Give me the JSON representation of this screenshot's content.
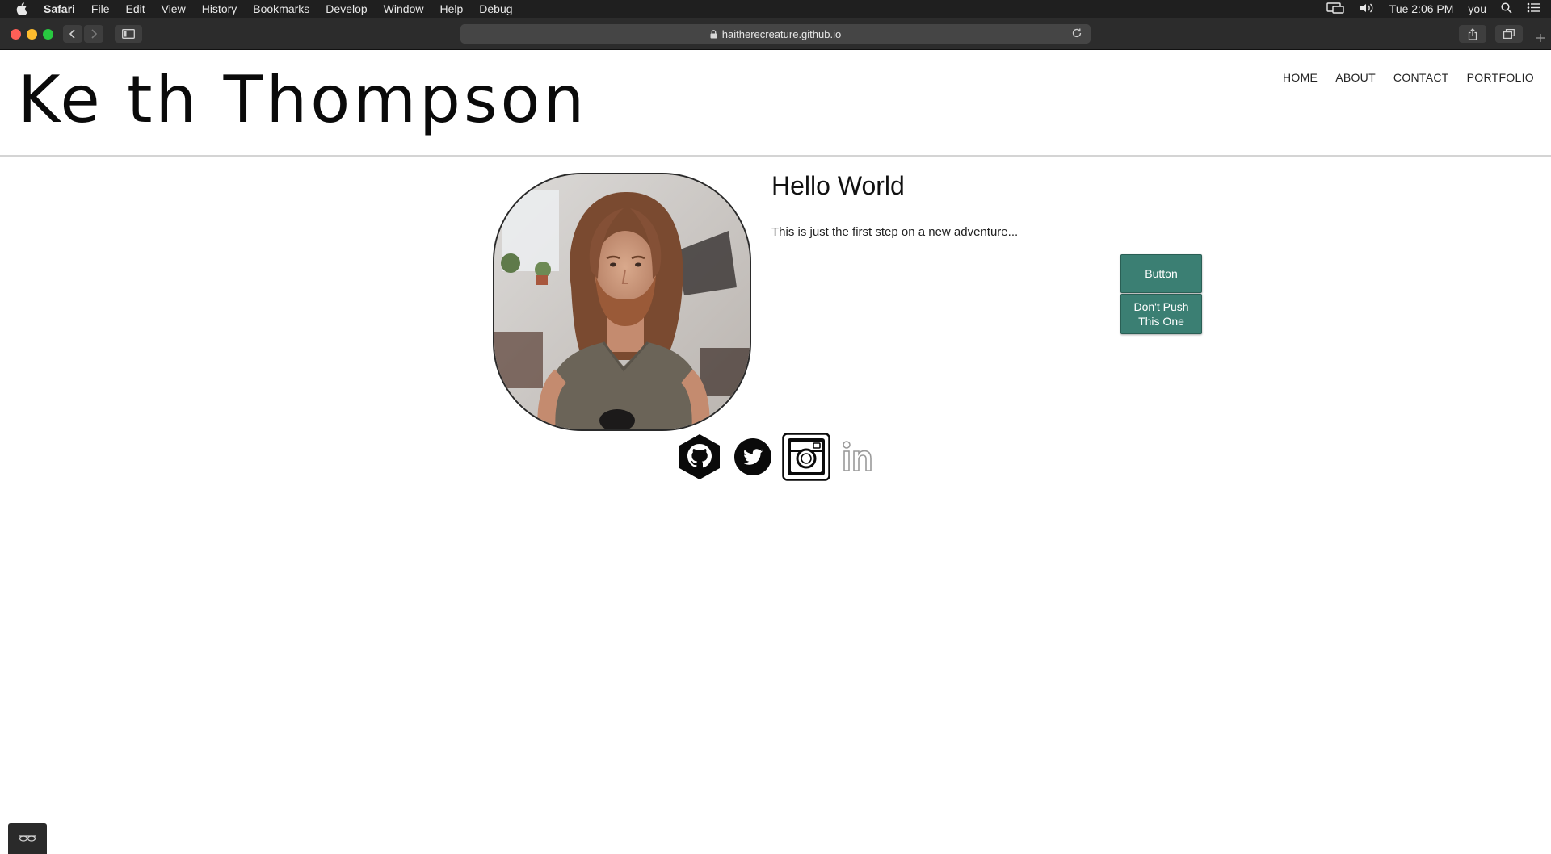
{
  "menubar": {
    "app_name": "Safari",
    "items": [
      "File",
      "Edit",
      "View",
      "History",
      "Bookmarks",
      "Develop",
      "Window",
      "Help",
      "Debug"
    ],
    "clock": "Tue 2:06 PM",
    "user": "you"
  },
  "browser": {
    "url": "haitherecreature.github.io"
  },
  "site": {
    "title": "Ke th Thompson",
    "nav": [
      "HOME",
      "ABOUT",
      "CONTACT",
      "PORTFOLIO"
    ],
    "heading": "Hello World",
    "tagline": "This is just the first step on a new adventure...",
    "button_primary": "Button",
    "button_secondary": "Don't Push This One",
    "social_icons": [
      "github-icon",
      "twitter-icon",
      "instagram-icon",
      "linkedin-icon"
    ]
  },
  "colors": {
    "accent": "#3b7f73",
    "menubar_bg": "#1f1f1f",
    "toolbar_bg": "#2c2c2c"
  }
}
